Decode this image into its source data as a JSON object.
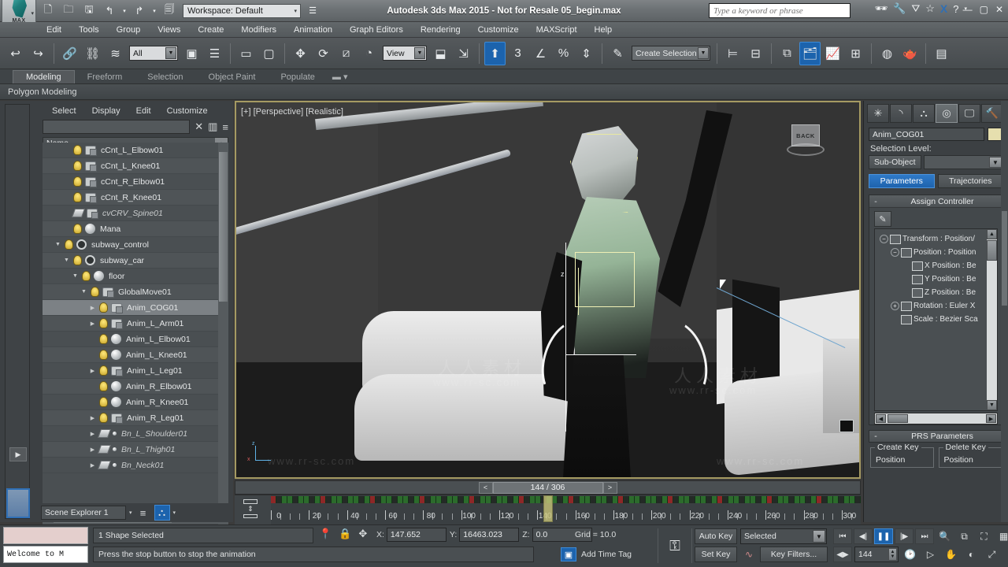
{
  "titlebar": {
    "app_title": "Autodesk 3ds Max  2015  - Not for Resale   05_begin.max",
    "workspace_label": "Workspace: Default",
    "search_placeholder": "Type a keyword or phrase",
    "quick_icons": [
      "new-file-icon",
      "open-file-icon",
      "save-file-icon",
      "undo-icon",
      "redo-icon",
      "project-folder-icon"
    ],
    "right_icons": [
      "binoculars-icon",
      "wrench-icon",
      "autodesk-a360-icon",
      "star-icon",
      "exchange-x-icon",
      "help-circle-icon"
    ],
    "window_buttons": [
      "minimize",
      "maximize",
      "close"
    ],
    "logo_label": "MAX"
  },
  "menubar": {
    "items": [
      "Edit",
      "Tools",
      "Group",
      "Views",
      "Create",
      "Modifiers",
      "Animation",
      "Graph Editors",
      "Rendering",
      "Customize",
      "MAXScript",
      "Help"
    ]
  },
  "toolbar": {
    "selection_filter": "All",
    "reference_coord": "View",
    "named_selection": "Create Selection Se",
    "snap_count": "3",
    "buttons": [
      "undo-icon",
      "redo-icon",
      "select-link-icon",
      "unlink-icon",
      "bind-space-warp-icon",
      "select-object-icon",
      "select-by-name-icon",
      "rectangular-region-icon",
      "window-crossing-icon",
      "select-move-icon",
      "select-rotate-icon",
      "select-scale-icon",
      "use-center-icon",
      "mirror-icon",
      "align-icon",
      "layer-manager-icon",
      "curve-editor-icon",
      "schematic-view-icon",
      "material-editor-icon",
      "render-setup-icon"
    ]
  },
  "ribbon": {
    "tabs": [
      "Modeling",
      "Freeform",
      "Selection",
      "Object Paint",
      "Populate"
    ],
    "active_tab": "Modeling",
    "panel_label": "Polygon Modeling"
  },
  "scene_explorer": {
    "menu": [
      "Select",
      "Display",
      "Edit",
      "Customize"
    ],
    "filter_value": "",
    "column_header": "Name",
    "bottom_combo": "Scene Explorer 1",
    "tree": [
      {
        "name": "cCnt_L_Elbow01",
        "indent": 2,
        "arrow": "",
        "icons": [
          "bulb",
          "helper"
        ],
        "italic": false,
        "selected": false
      },
      {
        "name": "cCnt_L_Knee01",
        "indent": 2,
        "arrow": "",
        "icons": [
          "bulb",
          "helper"
        ],
        "italic": false,
        "selected": false
      },
      {
        "name": "cCnt_R_Elbow01",
        "indent": 2,
        "arrow": "",
        "icons": [
          "bulb",
          "helper"
        ],
        "italic": false,
        "selected": false
      },
      {
        "name": "cCnt_R_Knee01",
        "indent": 2,
        "arrow": "",
        "icons": [
          "bulb",
          "helper"
        ],
        "italic": false,
        "selected": false
      },
      {
        "name": "cvCRV_Spine01",
        "indent": 2,
        "arrow": "",
        "icons": [
          "layer",
          "helper"
        ],
        "italic": true,
        "selected": false
      },
      {
        "name": "Mana",
        "indent": 2,
        "arrow": "",
        "icons": [
          "bulb",
          "sphere"
        ],
        "italic": false,
        "selected": false
      },
      {
        "name": "subway_control",
        "indent": 1,
        "arrow": "down",
        "icons": [
          "bulb",
          "circle"
        ],
        "italic": false,
        "selected": false
      },
      {
        "name": "subway_car",
        "indent": 2,
        "arrow": "down",
        "icons": [
          "bulb",
          "circle"
        ],
        "italic": false,
        "selected": false
      },
      {
        "name": "floor",
        "indent": 3,
        "arrow": "down",
        "icons": [
          "bulb",
          "sphere"
        ],
        "italic": false,
        "selected": false
      },
      {
        "name": "GlobalMove01",
        "indent": 4,
        "arrow": "down",
        "icons": [
          "bulb",
          "helper"
        ],
        "italic": false,
        "selected": false
      },
      {
        "name": "Anim_COG01",
        "indent": 5,
        "arrow": "right",
        "icons": [
          "bulb",
          "helper"
        ],
        "italic": false,
        "selected": true
      },
      {
        "name": "Anim_L_Arm01",
        "indent": 5,
        "arrow": "right",
        "icons": [
          "bulb",
          "helper"
        ],
        "italic": false,
        "selected": false
      },
      {
        "name": "Anim_L_Elbow01",
        "indent": 5,
        "arrow": "",
        "icons": [
          "bulb",
          "sphere"
        ],
        "italic": false,
        "selected": false
      },
      {
        "name": "Anim_L_Knee01",
        "indent": 5,
        "arrow": "",
        "icons": [
          "bulb",
          "sphere"
        ],
        "italic": false,
        "selected": false
      },
      {
        "name": "Anim_L_Leg01",
        "indent": 5,
        "arrow": "right",
        "icons": [
          "bulb",
          "helper"
        ],
        "italic": false,
        "selected": false
      },
      {
        "name": "Anim_R_Elbow01",
        "indent": 5,
        "arrow": "",
        "icons": [
          "bulb",
          "sphere"
        ],
        "italic": false,
        "selected": false
      },
      {
        "name": "Anim_R_Knee01",
        "indent": 5,
        "arrow": "",
        "icons": [
          "bulb",
          "sphere"
        ],
        "italic": false,
        "selected": false
      },
      {
        "name": "Anim_R_Leg01",
        "indent": 5,
        "arrow": "right",
        "icons": [
          "bulb",
          "helper"
        ],
        "italic": false,
        "selected": false
      },
      {
        "name": "Bn_L_Shoulder01",
        "indent": 5,
        "arrow": "right",
        "icons": [
          "layer",
          "dot"
        ],
        "italic": true,
        "selected": false
      },
      {
        "name": "Bn_L_Thigh01",
        "indent": 5,
        "arrow": "right",
        "icons": [
          "layer",
          "dot"
        ],
        "italic": true,
        "selected": false
      },
      {
        "name": "Bn_Neck01",
        "indent": 5,
        "arrow": "right",
        "icons": [
          "layer",
          "dot"
        ],
        "italic": true,
        "selected": false
      }
    ]
  },
  "viewport": {
    "label": "[+] [Perspective] [Realistic]",
    "viewcube_face": "BACK",
    "axis_labels": [
      "z",
      "x"
    ],
    "watermark_cn": "人人素材",
    "watermark_en": "www.rr-sc.com"
  },
  "frame_slider": {
    "text": "144 / 306",
    "prev": "<",
    "next": ">"
  },
  "command_panel": {
    "tabs": [
      "create-tab",
      "modify-tab",
      "hierarchy-tab",
      "motion-tab",
      "display-tab",
      "utilities-tab"
    ],
    "active_tab_index": 3,
    "object_name": "Anim_COG01",
    "selection_level_label": "Selection Level:",
    "sub_object_button": "Sub-Object",
    "sub_object_value": "",
    "parameters_button": "Parameters",
    "trajectories_button": "Trajectories",
    "assign_controller_header": "Assign Controller",
    "assign_controller_minus": "-",
    "controller_tree": [
      {
        "label": "Transform : Position/",
        "indent": 0,
        "expander": "minus"
      },
      {
        "label": "Position : Position",
        "indent": 1,
        "expander": "minus"
      },
      {
        "label": "X Position : Be",
        "indent": 2,
        "expander": ""
      },
      {
        "label": "Y Position : Be",
        "indent": 2,
        "expander": ""
      },
      {
        "label": "Z Position : Be",
        "indent": 2,
        "expander": ""
      },
      {
        "label": "Rotation : Euler X",
        "indent": 1,
        "expander": "plus"
      },
      {
        "label": "Scale : Bezier Sca",
        "indent": 1,
        "expander": ""
      }
    ],
    "prs_header": "PRS Parameters",
    "prs_minus": "-",
    "create_key_legend": "Create Key",
    "delete_key_legend": "Delete Key",
    "create_key_items": [
      "Position"
    ],
    "delete_key_items": [
      "Position"
    ]
  },
  "timebar": {
    "ticks": [
      0,
      20,
      40,
      60,
      80,
      100,
      120,
      140,
      160,
      180,
      200,
      220,
      240,
      260,
      280,
      300
    ],
    "current_frame": 144,
    "range_end": 306
  },
  "status": {
    "maxscript_listener_value": "",
    "maxscript_prompt": "Welcome to M",
    "selection_status": "1 Shape Selected",
    "prompt_line": "Press the stop button to stop the animation",
    "coord_x_label": "X:",
    "coord_x_value": "147.652",
    "coord_y_label": "Y:",
    "coord_y_value": "16463.023",
    "coord_z_label": "Z:",
    "coord_z_value": "0.0",
    "grid_label": "Grid = 10.0",
    "add_time_tag": "Add Time Tag",
    "tool_icons": [
      "isolate-selection-icon",
      "lock-selection-icon",
      "absolute-mode-icon"
    ]
  },
  "animation": {
    "auto_key": "Auto Key",
    "set_key": "Set Key",
    "key_mode_value": "Selected",
    "key_filters": "Key Filters...",
    "current_frame_value": "144",
    "transport": [
      "go-to-start-icon",
      "previous-frame-icon",
      "play-pause-icon",
      "next-frame-icon",
      "go-to-end-icon"
    ],
    "playing": true,
    "viewport_nav": [
      "zoom-icon",
      "zoom-all-icon",
      "zoom-extents-icon",
      "zoom-region-icon",
      "zoom-time-icon",
      "pan-icon",
      "hand-icon",
      "orbit-icon",
      "maximize-viewport-icon"
    ]
  }
}
